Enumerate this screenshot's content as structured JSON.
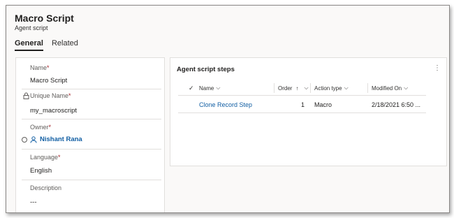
{
  "header": {
    "title": "Macro Script",
    "subtitle": "Agent script"
  },
  "tabs": [
    {
      "label": "General",
      "active": true
    },
    {
      "label": "Related",
      "active": false
    }
  ],
  "form": {
    "name": {
      "label": "Name",
      "required_mark": "*",
      "value": "Macro Script"
    },
    "unique_name": {
      "label": "Unique Name",
      "required_mark": "*",
      "value": "my_macroscript"
    },
    "owner": {
      "label": "Owner",
      "required_mark": "*",
      "value": "Nishant Rana"
    },
    "language": {
      "label": "Language",
      "required_mark": "*",
      "value": "English"
    },
    "description": {
      "label": "Description",
      "value": "---"
    }
  },
  "subgrid": {
    "title": "Agent script steps",
    "more_icon": "⋮",
    "columns": {
      "check": "✓",
      "name": "Name",
      "order": "Order",
      "action_type": "Action type",
      "modified_on": "Modified On"
    },
    "sort_icons": {
      "chevron": "⌵",
      "arrow_up": "↑"
    },
    "rows": [
      {
        "name": "Clone Record Step",
        "order": "1",
        "action_type": "Macro",
        "modified_on": "2/18/2021 6:50 ..."
      }
    ]
  },
  "icons": {
    "lock": "🔒︎",
    "status": "status-dot-icon",
    "person": "person-icon"
  },
  "colors": {
    "link": "#115ea3",
    "required": "#a4262c",
    "border": "#e1dfdd"
  }
}
